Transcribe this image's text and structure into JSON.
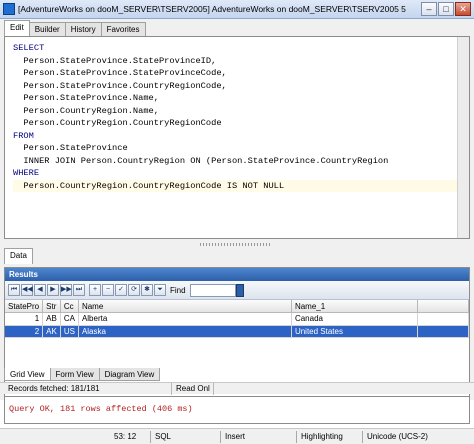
{
  "window": {
    "title": "[AdventureWorks on dooM_SERVER\\TSERV2005] AdventureWorks on dooM_SERVER\\TSERV2005 5",
    "min": "–",
    "max": "□",
    "close": "✕"
  },
  "editor_tabs": [
    "Edit",
    "Builder",
    "History",
    "Favorites"
  ],
  "sql_lines": [
    "SELECT",
    "  Person.StateProvince.StateProvinceID,",
    "  Person.StateProvince.StateProvinceCode,",
    "  Person.StateProvince.CountryRegionCode,",
    "  Person.StateProvince.Name,",
    "  Person.CountryRegion.Name,",
    "  Person.CountryRegion.CountryRegionCode",
    "FROM",
    "  Person.StateProvince",
    "  INNER JOIN Person.CountryRegion ON (Person.StateProvince.CountryRegion",
    "WHERE",
    "  Person.CountryRegion.CountryRegionCode IS NOT NULL"
  ],
  "data_tab": "Data",
  "results": {
    "title": "Results",
    "find_label": "Find",
    "nav_icons": [
      "first-icon",
      "prev-page-icon",
      "prev-icon",
      "next-icon",
      "next-page-icon",
      "last-icon",
      "insert-icon",
      "delete-icon",
      "post-icon",
      "refresh-icon",
      "cancel-icon",
      "filter-icon"
    ],
    "nav_glyphs": [
      "⏮",
      "◀◀",
      "◀",
      "▶",
      "▶▶",
      "⏭",
      "+",
      "−",
      "✓",
      "⟳",
      "✱",
      "⏷"
    ],
    "columns": [
      "StatePro",
      "Str",
      "Cc",
      "Name",
      "Name_1"
    ],
    "rows": [
      [
        "1",
        "AB",
        "CA",
        "Alberta",
        "Canada"
      ],
      [
        "2",
        "AK",
        "US",
        "Alaska",
        "United States"
      ]
    ]
  },
  "view_tabs": [
    "Grid View",
    "Form View",
    "Diagram View"
  ],
  "status_fetch": {
    "records": "Records fetched: 181/181",
    "readonly": "Read Onl"
  },
  "message": "Query OK, 181 rows affected (406 ms)",
  "statusbar": {
    "position": "53:  12",
    "mode": "SQL",
    "insert": "Insert",
    "highlight": "Highlighting",
    "encoding": "Unicode (UCS-2)"
  }
}
